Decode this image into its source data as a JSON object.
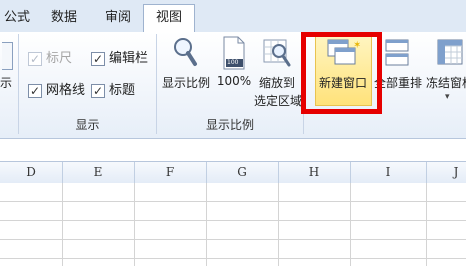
{
  "tabs": [
    {
      "label": "公式"
    },
    {
      "label": "数据"
    },
    {
      "label": "审阅"
    },
    {
      "label": "视图"
    }
  ],
  "partial_button_label": "示",
  "show_group": {
    "label": "显示",
    "checkboxes": [
      {
        "label": "标尺",
        "checked": true,
        "disabled": true
      },
      {
        "label": "编辑栏",
        "checked": true,
        "disabled": false
      },
      {
        "label": "网格线",
        "checked": true,
        "disabled": false
      },
      {
        "label": "标题",
        "checked": true,
        "disabled": false
      }
    ]
  },
  "zoom_group": {
    "label": "显示比例",
    "buttons": [
      {
        "label": "显示比例"
      },
      {
        "label": "100%",
        "icon_text": "100"
      },
      {
        "label_line1": "缩放到",
        "label_line2": "选定区域"
      }
    ]
  },
  "window_group": {
    "buttons": [
      {
        "label": "新建窗口",
        "highlighted": true
      },
      {
        "label": "全部重排"
      },
      {
        "label": "冻结窗格"
      }
    ]
  },
  "sheet": {
    "columns": [
      "D",
      "E",
      "F",
      "G",
      "H",
      "I",
      "J"
    ]
  },
  "colors": {
    "highlight": "#e60000",
    "ribbon_bg": "#eef3fa",
    "tab_bar": "#dfe9f5"
  }
}
